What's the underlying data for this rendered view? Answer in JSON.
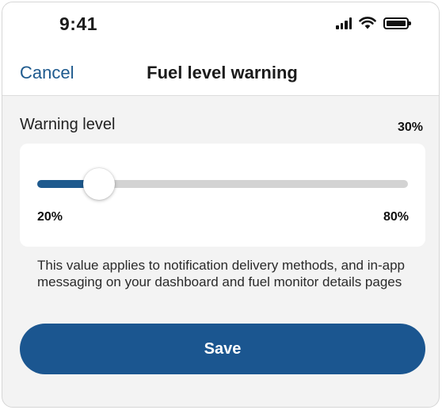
{
  "status_bar": {
    "time": "9:41",
    "icons": [
      "signal-icon",
      "wifi-icon",
      "battery-icon"
    ]
  },
  "header": {
    "cancel_label": "Cancel",
    "title": "Fuel level warning"
  },
  "warning_level": {
    "label": "Warning level",
    "value_text": "30%",
    "slider": {
      "min_label": "20%",
      "max_label": "80%",
      "min": 20,
      "max": 80,
      "value": 30
    },
    "help_text": "This value applies to notification delivery methods, and in-app messaging on your dashboard and fuel monitor details pages"
  },
  "save_label": "Save",
  "colors": {
    "accent": "#1e5a8e",
    "button": "#1b5690",
    "track": "#d3d3d3",
    "background": "#f3f3f3"
  }
}
